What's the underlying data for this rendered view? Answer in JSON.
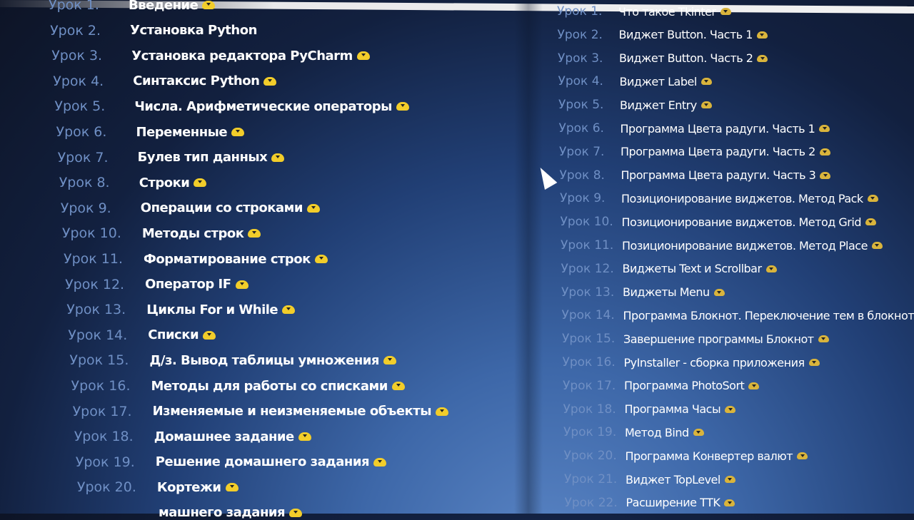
{
  "lesson_prefix": "Урок",
  "left_column": [
    {
      "num": "Урок 1.",
      "title": "Введение",
      "download": true
    },
    {
      "num": "Урок 2.",
      "title": "Установка Python",
      "download": false
    },
    {
      "num": "Урок 3.",
      "title": "Установка редактора PyCharm",
      "download": true
    },
    {
      "num": "Урок 4.",
      "title": "Синтаксис Python",
      "download": true
    },
    {
      "num": "Урок 5.",
      "title": "Числа. Арифметические операторы",
      "download": true
    },
    {
      "num": "Урок 6.",
      "title": "Переменные",
      "download": true
    },
    {
      "num": "Урок 7.",
      "title": "Булев тип данных",
      "download": true
    },
    {
      "num": "Урок 8.",
      "title": "Строки",
      "download": true
    },
    {
      "num": "Урок 9.",
      "title": "Операции со строками",
      "download": true
    },
    {
      "num": "Урок 10.",
      "title": "Методы строк",
      "download": true
    },
    {
      "num": "Урок 11.",
      "title": "Форматирование строк",
      "download": true
    },
    {
      "num": "Урок 12.",
      "title": "Оператор IF",
      "download": true
    },
    {
      "num": "Урок 13.",
      "title": "Циклы For и While",
      "download": true
    },
    {
      "num": "Урок 14.",
      "title": "Списки",
      "download": true
    },
    {
      "num": "Урок 15.",
      "title": "Д/з. Вывод таблицы умножения",
      "download": true
    },
    {
      "num": "Урок 16.",
      "title": "Методы для работы со списками",
      "download": true
    },
    {
      "num": "Урок 17.",
      "title": "Изменяемые и неизменяемые объекты",
      "download": true
    },
    {
      "num": "Урок 18.",
      "title": "Домашнее задание",
      "download": true
    },
    {
      "num": "Урок 19.",
      "title": "Решение домашнего задания",
      "download": true
    },
    {
      "num": "Урок 20.",
      "title": "Кортежи",
      "download": true
    },
    {
      "num": "",
      "title": "машнего задания",
      "download": true
    }
  ],
  "right_column": [
    {
      "num": "Урок 1.",
      "title": "Что такое Tkinter"
    },
    {
      "num": "Урок 2.",
      "title": "Виджет Button. Часть 1"
    },
    {
      "num": "Урок 3.",
      "title": "Виджет Button. Часть 2"
    },
    {
      "num": "Урок 4.",
      "title": "Виджет Label"
    },
    {
      "num": "Урок 5.",
      "title": "Виджет Entry"
    },
    {
      "num": "Урок 6.",
      "title": "Программа Цвета радуги. Часть 1"
    },
    {
      "num": "Урок 7.",
      "title": "Программа Цвета радуги. Часть 2"
    },
    {
      "num": "Урок 8.",
      "title": "Программа Цвета радуги. Часть 3"
    },
    {
      "num": "Урок 9.",
      "title": "Позиционирование виджетов. Метод Pack"
    },
    {
      "num": "Урок 10.",
      "title": "Позиционирование виджетов. Метод Grid"
    },
    {
      "num": "Урок 11.",
      "title": "Позиционирование виджетов. Метод Place"
    },
    {
      "num": "Урок 12.",
      "title": "Виджеты Text и Scrollbar"
    },
    {
      "num": "Урок 13.",
      "title": "Виджеты Menu"
    },
    {
      "num": "Урок 14.",
      "title": "Программа Блокнот. Переключение тем в блокноте"
    },
    {
      "num": "Урок 15.",
      "title": "Завершение программы Блокнот"
    },
    {
      "num": "Урок 16.",
      "title": "PyInstaller - сборка приложения"
    },
    {
      "num": "Урок 17.",
      "title": "Программа PhotoSort"
    },
    {
      "num": "Урок 18.",
      "title": "Программа Часы"
    },
    {
      "num": "Урок 19.",
      "title": "Метод Bind"
    },
    {
      "num": "Урок 20.",
      "title": "Программа Конвертер валют"
    },
    {
      "num": "Урок 21.",
      "title": "Виджет TopLevel"
    },
    {
      "num": "Урок 22.",
      "title": "Расширение TTK"
    }
  ],
  "colors": {
    "number": "#6f8fc4",
    "title": "#ffffff",
    "download_icon": "#f2cd2a"
  }
}
